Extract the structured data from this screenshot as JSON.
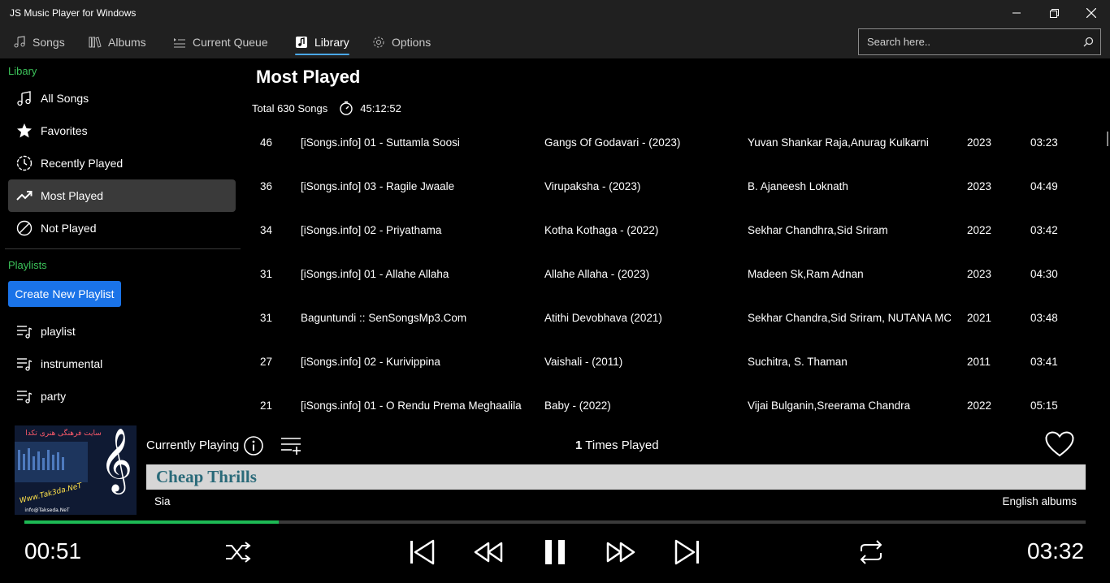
{
  "window": {
    "title": "JS Music Player for Windows"
  },
  "nav": {
    "tabs": [
      {
        "label": "Songs",
        "icon": "music-note-icon"
      },
      {
        "label": "Albums",
        "icon": "albums-icon"
      },
      {
        "label": "Current Queue",
        "icon": "queue-icon"
      },
      {
        "label": "Library",
        "icon": "library-icon",
        "active": true
      },
      {
        "label": "Options",
        "icon": "gear-icon"
      }
    ],
    "search_placeholder": "Search here.."
  },
  "sidebar": {
    "library_label": "Libary",
    "library_items": [
      {
        "label": "All Songs"
      },
      {
        "label": "Favorites"
      },
      {
        "label": "Recently Played"
      },
      {
        "label": "Most Played",
        "active": true
      },
      {
        "label": "Not Played"
      }
    ],
    "playlists_label": "Playlists",
    "create_button": "Create New Playlist",
    "playlists": [
      {
        "label": "playlist"
      },
      {
        "label": "instrumental"
      },
      {
        "label": "party"
      }
    ]
  },
  "main": {
    "title": "Most Played",
    "total": "Total 630 Songs",
    "duration": "45:12:52",
    "songs": [
      {
        "count": "46",
        "title": "[iSongs.info] 01 - Suttamla Soosi",
        "album": "Gangs Of Godavari - (2023)",
        "artist": "Yuvan Shankar Raja,Anurag Kulkarni",
        "year": "2023",
        "length": "03:23"
      },
      {
        "count": "36",
        "title": "[iSongs.info] 03 - Ragile Jwaale",
        "album": "Virupaksha - (2023)",
        "artist": "B. Ajaneesh Loknath",
        "year": "2023",
        "length": "04:49"
      },
      {
        "count": "34",
        "title": "[iSongs.info] 02 - Priyathama",
        "album": "Kotha Kothaga - (2022)",
        "artist": "Sekhar Chandhra,Sid Sriram",
        "year": "2022",
        "length": "03:42"
      },
      {
        "count": "31",
        "title": "[iSongs.info] 01 - Allahe Allaha",
        "album": "Allahe Allaha - (2023)",
        "artist": "Madeen Sk,Ram Adnan",
        "year": "2023",
        "length": "04:30"
      },
      {
        "count": "31",
        "title": "Baguntundi :: SenSongsMp3.Com",
        "album": "Atithi Devobhava (2021)",
        "artist": "Sekhar Chandra,Sid Sriram, NUTANA MC",
        "year": "2021",
        "length": "03:48"
      },
      {
        "count": "27",
        "title": "[iSongs.info] 02 - Kurivippina",
        "album": "Vaishali - (2011)",
        "artist": "Suchitra, S. Thaman",
        "year": "2011",
        "length": "03:41"
      },
      {
        "count": "21",
        "title": "[iSongs.info] 01 - O Rendu Prema Meghaalila",
        "album": "Baby - (2022)",
        "artist": "Vijai Bulganin,Sreerama Chandra",
        "year": "2022",
        "length": "05:15"
      }
    ]
  },
  "player": {
    "label": "Currently Playing",
    "times_count": "1",
    "times_label": "Times Played",
    "song_title": "Cheap Thrills",
    "artist": "Sia",
    "album": "English albums",
    "elapsed": "00:51",
    "total": "03:32",
    "progress_fraction": 0.24,
    "art_text": {
      "line1": "سایت فرهنگی هنری تکدا",
      "site": "Www.Tak3da.NeT",
      "email": "info@Takseda.NeT"
    },
    "accent_progress": "#1db954"
  }
}
